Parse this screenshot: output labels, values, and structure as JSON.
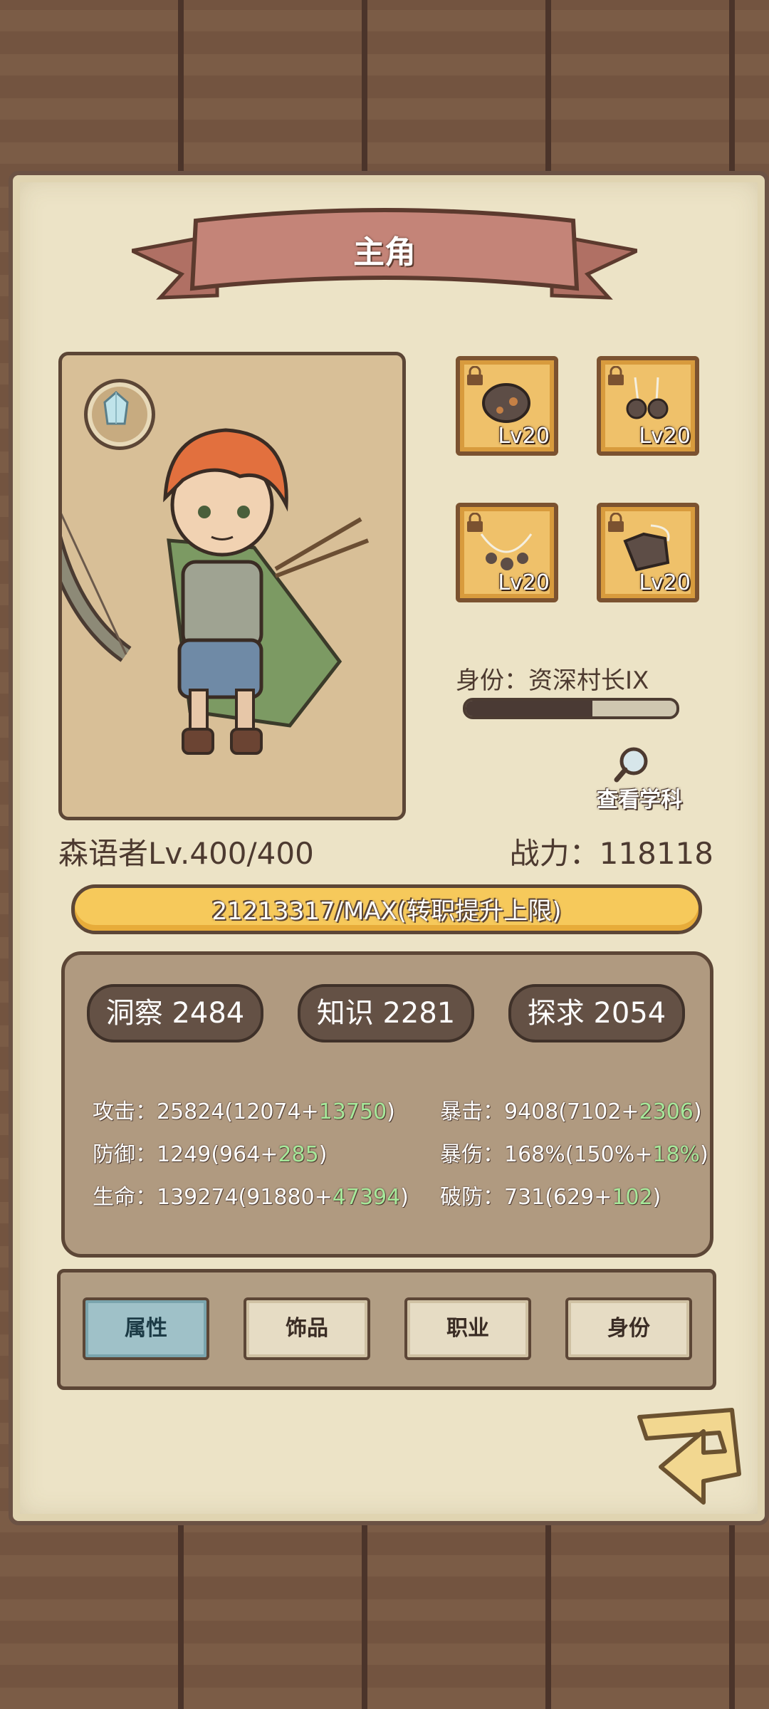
{
  "header": {
    "title": "主角"
  },
  "equipment": [
    {
      "name": "rock-head",
      "level": "Lv20"
    },
    {
      "name": "rock-earrings",
      "level": "Lv20"
    },
    {
      "name": "rock-necklace",
      "level": "Lv20"
    },
    {
      "name": "rock-gauntlet",
      "level": "Lv20"
    }
  ],
  "identity": {
    "label": "身份：资深村长IX",
    "progress": 0.6
  },
  "view_subject_label": "查看学科",
  "character": {
    "class_level": "森语者Lv.400/400",
    "power": "战力：118118"
  },
  "experience": {
    "text": "21213317/MAX(转职提升上限)"
  },
  "attributes": [
    {
      "label": "洞察 2484"
    },
    {
      "label": "知识 2281"
    },
    {
      "label": "探求 2054"
    }
  ],
  "stats": [
    {
      "label": "攻击：",
      "base": "25824(12074+",
      "bonus": "13750",
      "end": ")"
    },
    {
      "label": "防御：",
      "base": "1249(964+",
      "bonus": "285",
      "end": ")"
    },
    {
      "label": "生命：",
      "base": "139274(91880+",
      "bonus": "47394",
      "end": ")"
    },
    {
      "label": "暴击：",
      "base": "9408(7102+",
      "bonus": "2306",
      "end": ")"
    },
    {
      "label": "暴伤：",
      "base": "168%(150%+",
      "bonus": "18%",
      "end": ")"
    },
    {
      "label": "破防：",
      "base": "731(629+",
      "bonus": "102",
      "end": ")"
    }
  ],
  "tabs": [
    {
      "label": "属性",
      "active": true
    },
    {
      "label": "饰品",
      "active": false
    },
    {
      "label": "职业",
      "active": false
    },
    {
      "label": "身份",
      "active": false
    }
  ],
  "colors": {
    "paper": "#ece3c6",
    "ribbon": "#c48478",
    "exp_bar": "#f6c95b",
    "bonus_green": "#a6e89a",
    "active_tab": "#9fc1c8"
  }
}
